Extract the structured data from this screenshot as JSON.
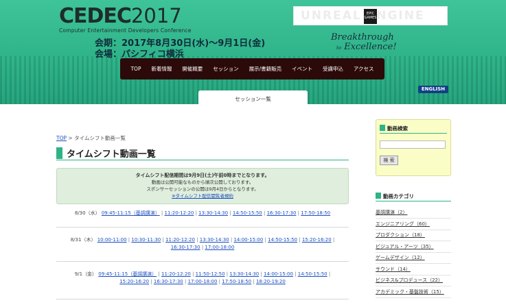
{
  "header": {
    "logo_main": "CEDEC",
    "logo_year": "2017",
    "logo_sub": "Computer Entertainment Developers Conference",
    "period": "会期：2017年8月30日(水)～9月1日(金)",
    "venue": "会場：パシフィコ横浜",
    "sponsor_text": "UNREAL ENGINE",
    "sponsor_badge": "EPIC GAMES",
    "tagline_line1": "Breakthrough",
    "tagline_to": "to",
    "tagline_line2": "Excellence!",
    "english_label": "ENGLISH",
    "current_tab": "セッション一覧"
  },
  "nav": {
    "items": [
      "TOP",
      "新着情報",
      "開催概要",
      "セッション",
      "展示/書籍販売",
      "イベント",
      "受講申込",
      "アクセス"
    ]
  },
  "breadcrumb": {
    "home": "TOP",
    "separator": " > ",
    "current": "タイムシフト動画一覧"
  },
  "page_title": "タイムシフト動画一覧",
  "notice": {
    "line1": "タイムシフト配信期間は9月9日(土)午前0時までとなります。",
    "line2": "動画は公開可能なものから順次公開しております。",
    "line3": "スポンサーセッションの公開は9月4日からとなります。",
    "link": "※タイムシフト配信閲覧者規約"
  },
  "schedule": [
    {
      "date": "8/30（水）",
      "lines": [
        [
          "09:45-11:15（基調講演）",
          "11:20-12:20",
          "13:30-14:30",
          "14:50-15:50",
          "16:30-17:30",
          "17:50-18:50"
        ]
      ]
    },
    {
      "date": "8/31（木）",
      "lines": [
        [
          "10:00-11:00",
          "10:30-11:30",
          "11:20-12:20",
          "13:30-14:30",
          "14:00-15:00",
          "14:50-15:50",
          "15:20-16:20"
        ],
        [
          "16:30-17:30",
          "17:00-18:00"
        ]
      ]
    },
    {
      "date": "9/1（金）",
      "lines": [
        [
          "09:45-11:15（基調講演）",
          "11:20-12:20",
          "11:50-12:50",
          "13:30-14:30",
          "14:00-15:00",
          "14:50-15:50"
        ],
        [
          "15:20-16:20",
          "16:30-17:30",
          "17:00-18:00",
          "17:50-18:50",
          "18:20-19:20"
        ]
      ]
    }
  ],
  "sidebar": {
    "search_title": "動画検索",
    "search_button": "検 索",
    "search_value": "",
    "category_title": "動画カテゴリ",
    "categories": [
      "基調講演（2）",
      "エンジニアリング（60）",
      "プロダクション（18）",
      "ビジュアル・アーツ（35）",
      "ゲームデザイン（12）",
      "サウンド（14）",
      "ビジネス&プロデュース（22）",
      "アカデミック・基盤技術（15）"
    ]
  },
  "colors": {
    "accent": "#2db386",
    "nav_bg": "#2c0a0a",
    "link": "#1a4ec2",
    "notice_bg": "#dfeedd",
    "search_bg": "#fbfdc7"
  }
}
